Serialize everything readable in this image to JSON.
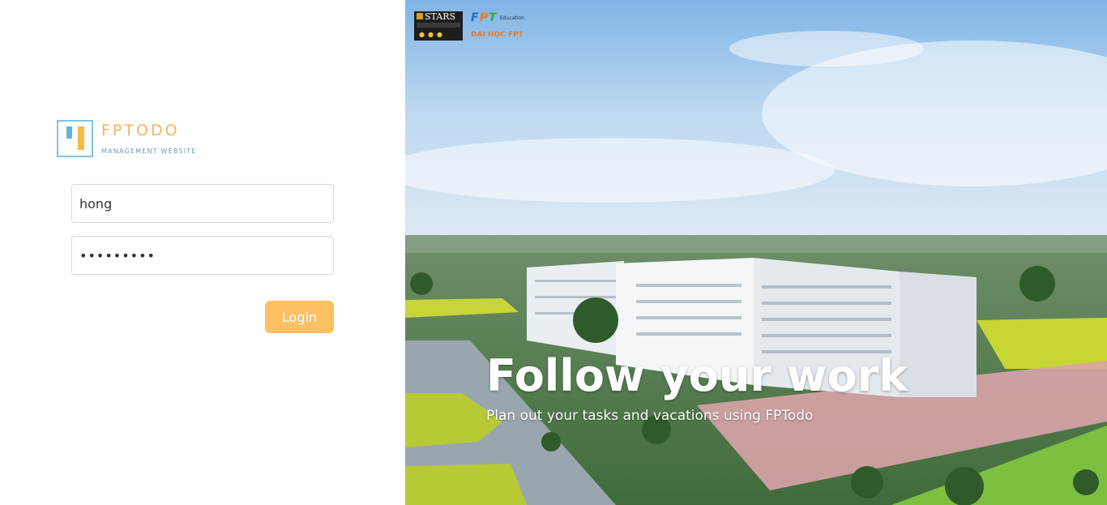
{
  "brand": {
    "name": "FPTODO",
    "tagline": "MANAGEMENT WEBSITE"
  },
  "login_form": {
    "username_value": "hong",
    "password_value": "•••••••••",
    "login_label": "Login"
  },
  "hero": {
    "title": "Follow your work",
    "subtitle": "Plan out your tasks and vacations using FPTodo",
    "stars_badge_text": "STARS",
    "fpt_logo_text": "FPT",
    "fpt_education_text": "Education",
    "university_text": "ĐẠI HỌC FPT"
  },
  "colors": {
    "accent": "#fdc062",
    "brand_orange": "#f5b25a",
    "brand_blue": "#5ab6e6"
  }
}
